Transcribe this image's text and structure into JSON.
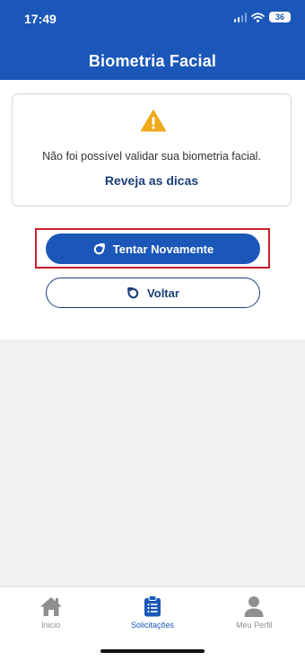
{
  "status_bar": {
    "time": "17:49",
    "battery": "36",
    "signal_icon": "cellular-signal",
    "wifi_icon": "wifi"
  },
  "header": {
    "title": "Biometria Facial"
  },
  "alert_card": {
    "icon": "warning-triangle",
    "message": "Não foi possível validar sua biometria facial.",
    "link_label": "Reveja as dicas"
  },
  "actions": {
    "retry_label": "Tentar Novamente",
    "retry_icon": "refresh-clockwise",
    "back_label": "Voltar",
    "back_icon": "refresh-counterclockwise"
  },
  "tab_bar": {
    "active": "Solicitações",
    "items": [
      {
        "label": "Inicio",
        "icon": "home"
      },
      {
        "label": "Solicitações",
        "icon": "clipboard-list"
      },
      {
        "label": "Meu Perfil",
        "icon": "person"
      }
    ]
  },
  "colors": {
    "primary": "#1a57b8",
    "link_text": "#1a3f7a",
    "warning": "#f0a81c",
    "highlight_border": "#c8202a",
    "inactive_tab": "#8f8f8f"
  }
}
